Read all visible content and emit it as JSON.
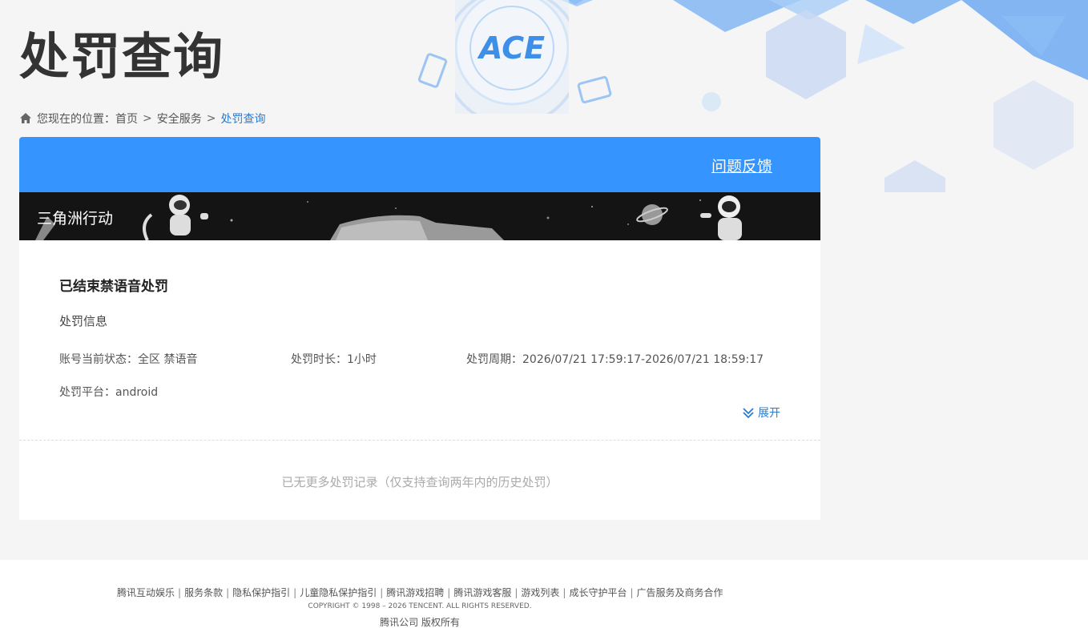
{
  "page": {
    "title": "处罚查询"
  },
  "logo": {
    "text": "ACE"
  },
  "breadcrumb": {
    "prefix": "您现在的位置：",
    "items": [
      "首页",
      "安全服务",
      "处罚查询"
    ],
    "separator": ">"
  },
  "card": {
    "feedback_label": "问题反馈",
    "game_name": "三角洲行动"
  },
  "record": {
    "title": "已结束禁语音处罚",
    "subtitle": "处罚信息",
    "status": "账号当前状态：全区 禁语音",
    "duration": "处罚时长：1小时",
    "period": "处罚周期：2026/07/21 17:59:17-2026/07/21 18:59:17",
    "platform": "处罚平台：android",
    "expand_label": "展开"
  },
  "no_more_text": "已无更多处罚记录（仅支持查询两年内的历史处罚）",
  "footer": {
    "links": [
      "腾讯互动娱乐",
      "服务条款",
      "隐私保护指引",
      "儿童隐私保护指引",
      "腾讯游戏招聘",
      "腾讯游戏客服",
      "游戏列表",
      "成长守护平台",
      "广告服务及商务合作"
    ],
    "separator": "|",
    "copyright": "COPYRIGHT © 1998 – 2026 TENCENT. ALL RIGHTS RESERVED.",
    "rights": "腾讯公司 版权所有"
  },
  "colors": {
    "accent": "#3694fe",
    "link": "#2a7bd3",
    "banner": "#141414"
  },
  "icons": {
    "home": "home-icon",
    "expand": "double-chevron-down-icon"
  }
}
